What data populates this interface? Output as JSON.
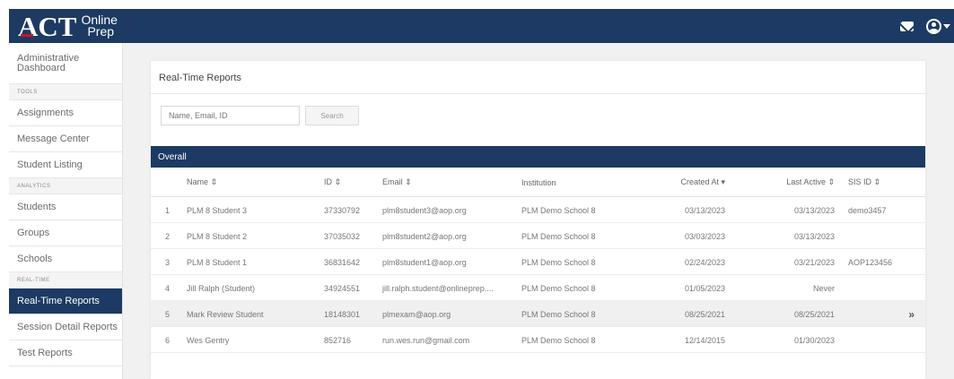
{
  "header": {
    "logo_main": "ACT",
    "logo_line1": "Online",
    "logo_line2": "Prep",
    "icons": [
      "mail-icon",
      "user-icon",
      "chevron-down-icon"
    ]
  },
  "sidebar": {
    "dashboard": "Administrative Dashboard",
    "section_tools": "TOOLS",
    "tools": [
      "Assignments",
      "Message Center",
      "Student Listing"
    ],
    "section_analytics": "ANALYTICS",
    "analytics": [
      "Students",
      "Groups",
      "Schools"
    ],
    "section_realtime": "REAL-TIME",
    "realtime": [
      "Real-Time Reports",
      "Session Detail Reports",
      "Test Reports"
    ]
  },
  "main": {
    "title": "Real-Time Reports",
    "search_placeholder": "Name, Email, ID",
    "search_button": "Search",
    "section_label": "Overall",
    "columns": {
      "name": "Name ⇕",
      "id": "ID ⇕",
      "email": "Email ⇕",
      "institution": "Institution",
      "created": "Created At ▾",
      "last_active": "Last Active ⇕",
      "sis_id": "SIS ID ⇕"
    },
    "rows": [
      {
        "n": "1",
        "name": "PLM 8 Student 3",
        "id": "37330792",
        "email": "plm8student3@aop.org",
        "institution": "PLM Demo School 8",
        "created": "03/13/2023",
        "last_active": "03/13/2023",
        "sis": "demo3457"
      },
      {
        "n": "2",
        "name": "PLM 8 Student 2",
        "id": "37035032",
        "email": "plm8student2@aop.org",
        "institution": "PLM Demo School 8",
        "created": "03/03/2023",
        "last_active": "03/13/2023",
        "sis": ""
      },
      {
        "n": "3",
        "name": "PLM 8 Student 1",
        "id": "36831642",
        "email": "plm8student1@aop.org",
        "institution": "PLM Demo School 8",
        "created": "02/24/2023",
        "last_active": "03/21/2023",
        "sis": "AOP123456"
      },
      {
        "n": "4",
        "name": "Jill Ralph (Student)",
        "id": "34924551",
        "email": "jill.ralph.student@onlineprep....",
        "institution": "PLM Demo School 8",
        "created": "01/05/2023",
        "last_active": "Never",
        "sis": ""
      },
      {
        "n": "5",
        "name": "Mark Review Student",
        "id": "18148301",
        "email": "plmexam@aop.org",
        "institution": "PLM Demo School 8",
        "created": "08/25/2021",
        "last_active": "08/25/2021",
        "sis": ""
      },
      {
        "n": "6",
        "name": "Wes Gentry",
        "id": "852716",
        "email": "run.wes.run@gmail.com",
        "institution": "PLM Demo School 8",
        "created": "12/14/2015",
        "last_active": "01/30/2023",
        "sis": ""
      }
    ],
    "row_chevron": "»"
  }
}
